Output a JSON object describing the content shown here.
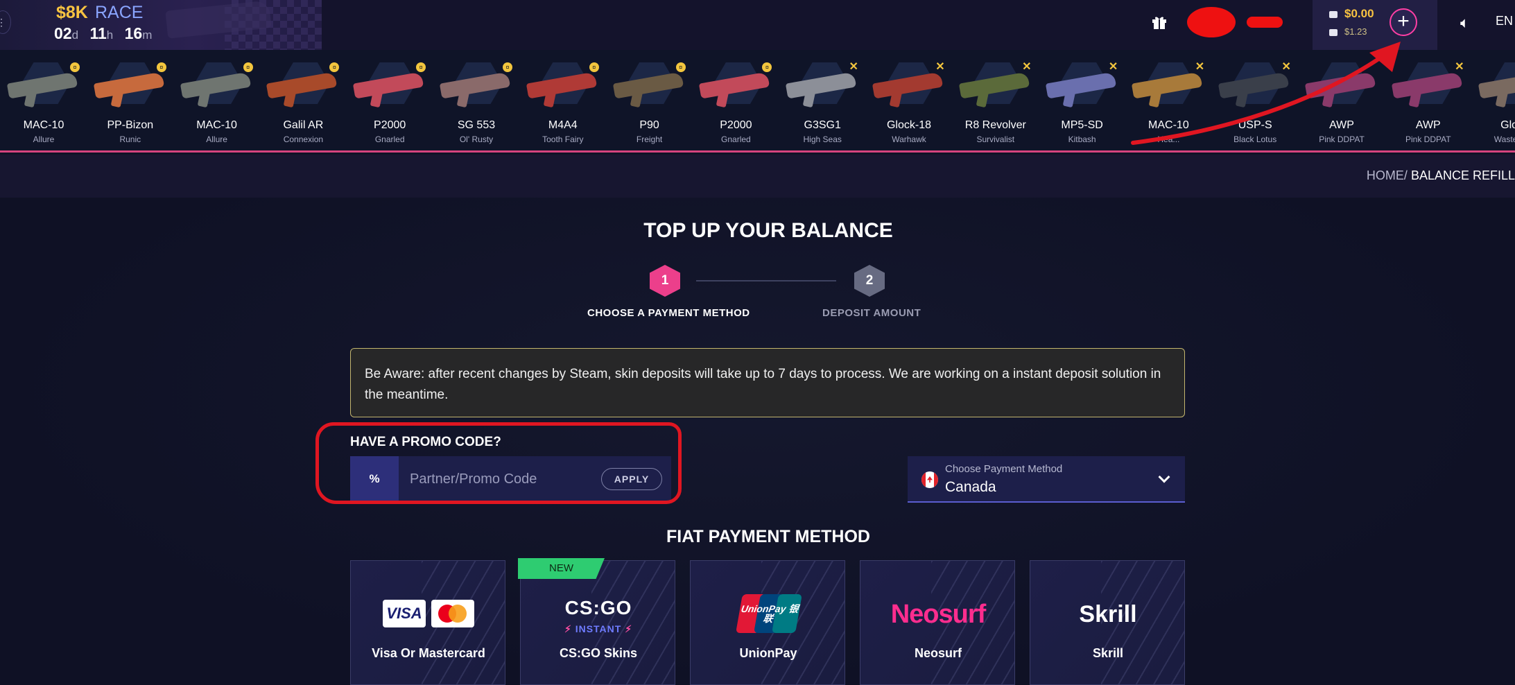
{
  "header": {
    "race_amount": "$8K",
    "race_label": "RACE",
    "timer": {
      "days": "02",
      "days_unit": "d",
      "hours": "11",
      "hours_unit": "h",
      "minutes": "16",
      "minutes_unit": "m"
    },
    "balance_main": "$0.00",
    "balance_sub": "$1.23",
    "add_funds_label": "+",
    "language": "EN"
  },
  "drops": [
    {
      "name": "MAC-10",
      "skin": "Allure",
      "badge": "coin",
      "color": "#6f7570"
    },
    {
      "name": "PP-Bizon",
      "skin": "Runic",
      "badge": "coin",
      "color": "#c76a3d"
    },
    {
      "name": "MAC-10",
      "skin": "Allure",
      "badge": "coin",
      "color": "#6f7570"
    },
    {
      "name": "Galil AR",
      "skin": "Connexion",
      "badge": "coin",
      "color": "#a84a2a"
    },
    {
      "name": "P2000",
      "skin": "Gnarled",
      "badge": "coin",
      "color": "#c24a5a"
    },
    {
      "name": "SG 553",
      "skin": "Ol' Rusty",
      "badge": "coin",
      "color": "#8a6a6a"
    },
    {
      "name": "M4A4",
      "skin": "Tooth Fairy",
      "badge": "coin",
      "color": "#b03a36"
    },
    {
      "name": "P90",
      "skin": "Freight",
      "badge": "coin",
      "color": "#6a5a44"
    },
    {
      "name": "P2000",
      "skin": "Gnarled",
      "badge": "coin",
      "color": "#c24a5a"
    },
    {
      "name": "G3SG1",
      "skin": "High Seas",
      "badge": "x",
      "color": "#8c8f98"
    },
    {
      "name": "Glock-18",
      "skin": "Warhawk",
      "badge": "x",
      "color": "#a33a30"
    },
    {
      "name": "R8 Revolver",
      "skin": "Survivalist",
      "badge": "x",
      "color": "#5b6a3a"
    },
    {
      "name": "MP5-SD",
      "skin": "Kitbash",
      "badge": "x",
      "color": "#6a6fae"
    },
    {
      "name": "MAC-10",
      "skin": "Hea...",
      "badge": "x",
      "color": "#a87a3a"
    },
    {
      "name": "USP-S",
      "skin": "Black Lotus",
      "badge": "x",
      "color": "#3a3f4a"
    },
    {
      "name": "AWP",
      "skin": "Pink DDPAT",
      "badge": "none",
      "color": "#8a3a6a"
    },
    {
      "name": "AWP",
      "skin": "Pink DDPAT",
      "badge": "x",
      "color": "#8a3a6a"
    },
    {
      "name": "Glock",
      "skin": "Wastelan...",
      "badge": "none",
      "color": "#7a6a60"
    }
  ],
  "breadcrumb": {
    "home": "HOME",
    "separator": "/",
    "current": "BALANCE REFILL"
  },
  "page_title": "TOP UP YOUR BALANCE",
  "steps": [
    {
      "number": "1",
      "label": "CHOOSE A PAYMENT METHOD"
    },
    {
      "number": "2",
      "label": "DEPOSIT AMOUNT"
    }
  ],
  "notice": "Be Aware: after recent changes by Steam, skin deposits will take up to 7 days to process. We are working on a instant deposit solution in the meantime.",
  "promo": {
    "title": "HAVE A PROMO CODE?",
    "icon_text": "%",
    "placeholder": "Partner/Promo Code",
    "value": "",
    "apply_label": "APPLY"
  },
  "payment_select": {
    "label": "Choose Payment Method",
    "value": "Canada"
  },
  "fiat_title": "FIAT PAYMENT METHOD",
  "methods": [
    {
      "name": "Visa Or Mastercard",
      "logo": "VISA"
    },
    {
      "name": "CS:GO Skins",
      "logo": "CS:GO",
      "tag": "INSTANT",
      "badge": "NEW"
    },
    {
      "name": "UnionPay",
      "logo": "UnionPay 银联"
    },
    {
      "name": "Neosurf",
      "logo": "Neosurf"
    },
    {
      "name": "Skrill",
      "logo": "Skrill"
    }
  ],
  "colors": {
    "accent_pink": "#ec3f8b",
    "gold": "#f8c341",
    "annotation_red": "#e01621",
    "new_green": "#2ecc71"
  }
}
